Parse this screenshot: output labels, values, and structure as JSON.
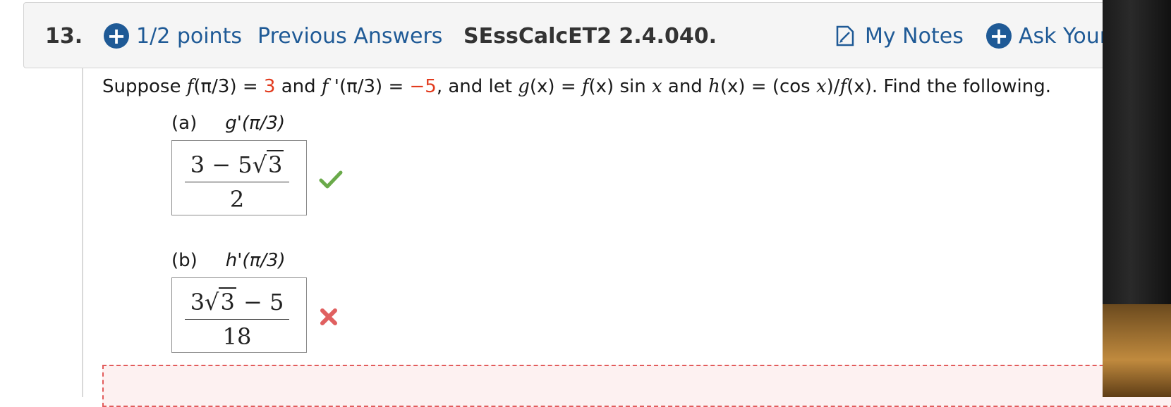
{
  "header": {
    "question_number": "13.",
    "points": "1/2 points",
    "previous_answers": "Previous Answers",
    "assignment_id": "SEssCalcET2 2.4.040.",
    "my_notes": "My Notes",
    "ask_teacher": "Ask Your",
    "plus_icon": "plus-circle-icon",
    "note_icon": "note-icon"
  },
  "question": {
    "p1": "Suppose  ",
    "f_of": "f",
    "p2": "(π/3)  =  ",
    "f_val": "3",
    "p3": " and ",
    "fp_of": "f",
    "p4": " '(π/3)  =  ",
    "fp_val": "−5",
    "p5": ",  and let  ",
    "g": "g",
    "p6": "(x)  =  ",
    "gf": "f",
    "p7": "(x) sin ",
    "gx": "x",
    "p8": "  and  ",
    "h": "h",
    "p9": "(x)  =  (cos ",
    "hx": "x",
    "p10": ")/",
    "hf": "f",
    "p11": "(x).  Find the following."
  },
  "parts": [
    {
      "label": "(a)",
      "expression": "g'(π/3)",
      "answer": {
        "num_a": "3 − 5",
        "num_rad": "3",
        "num_b": "",
        "den": "2"
      },
      "status": "correct",
      "status_icon": "check-icon"
    },
    {
      "label": "(b)",
      "expression": "h'(π/3)",
      "answer": {
        "num_a": "3",
        "num_rad": "3",
        "num_b": " − 5",
        "den": "18"
      },
      "status": "incorrect",
      "status_icon": "cross-icon"
    }
  ],
  "colors": {
    "link_blue": "#1f5a96",
    "given_value_red": "#e23b1e",
    "correct_green": "#6aaa4a",
    "incorrect_red": "#e06060"
  }
}
